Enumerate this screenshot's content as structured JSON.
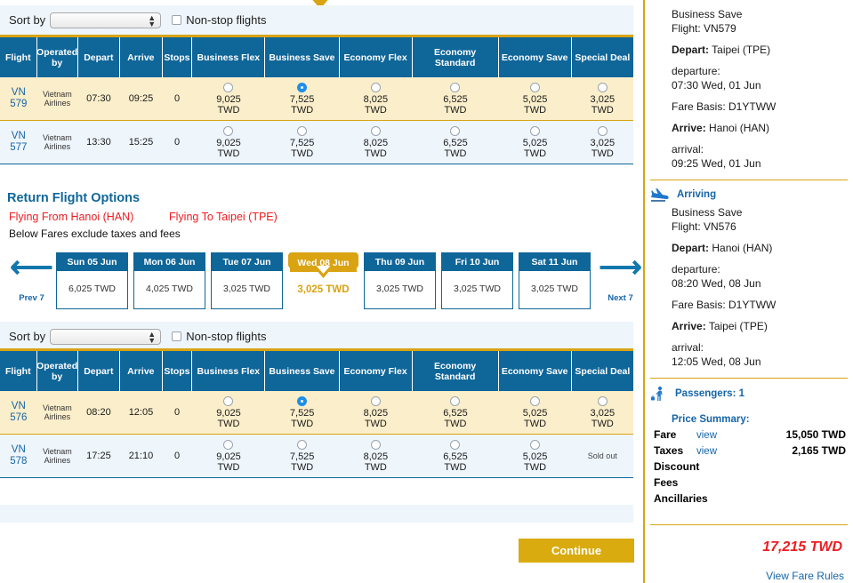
{
  "left": {
    "outbound_sortbar": {
      "sort_label": "Sort by",
      "sort_value": "",
      "nonstop_label": "Non-stop flights"
    },
    "return_sortbar": {
      "sort_label": "Sort by",
      "sort_value": "",
      "nonstop_label": "Non-stop flights"
    },
    "table_headers": [
      "Flight",
      "Operated by",
      "Depart",
      "Arrive",
      "Stops",
      "Business Flex",
      "Business Save",
      "Economy Flex",
      "Economy Standard",
      "Economy Save",
      "Special Deal"
    ],
    "outbound_rows": [
      {
        "flight": "VN 579",
        "operated_by": "Vietnam Airlines",
        "depart": "07:30",
        "arrive": "09:25",
        "stops": "0",
        "fares": [
          {
            "price": "9,025",
            "currency": "TWD",
            "selected": false,
            "sold_out": false
          },
          {
            "price": "7,525",
            "currency": "TWD",
            "selected": true,
            "sold_out": false
          },
          {
            "price": "8,025",
            "currency": "TWD",
            "selected": false,
            "sold_out": false
          },
          {
            "price": "6,525",
            "currency": "TWD",
            "selected": false,
            "sold_out": false
          },
          {
            "price": "5,025",
            "currency": "TWD",
            "selected": false,
            "sold_out": false
          },
          {
            "price": "3,025",
            "currency": "TWD",
            "selected": false,
            "sold_out": false
          }
        ]
      },
      {
        "flight": "VN 577",
        "operated_by": "Vietnam Airlines",
        "depart": "13:30",
        "arrive": "15:25",
        "stops": "0",
        "fares": [
          {
            "price": "9,025",
            "currency": "TWD",
            "selected": false,
            "sold_out": false
          },
          {
            "price": "7,525",
            "currency": "TWD",
            "selected": false,
            "sold_out": false
          },
          {
            "price": "8,025",
            "currency": "TWD",
            "selected": false,
            "sold_out": false
          },
          {
            "price": "6,525",
            "currency": "TWD",
            "selected": false,
            "sold_out": false
          },
          {
            "price": "5,025",
            "currency": "TWD",
            "selected": false,
            "sold_out": false
          },
          {
            "price": "3,025",
            "currency": "TWD",
            "selected": false,
            "sold_out": false
          }
        ]
      }
    ],
    "return_section": {
      "title": "Return Flight Options",
      "flying_from": "Flying From Hanoi (HAN)",
      "flying_to": "Flying To Taipei (TPE)",
      "note": "Below Fares exclude taxes and fees",
      "prev_label": "Prev 7",
      "next_label": "Next 7",
      "dates": [
        {
          "day": "Sun 05 Jun",
          "price": "6,025 TWD",
          "selected": false
        },
        {
          "day": "Mon 06 Jun",
          "price": "4,025 TWD",
          "selected": false
        },
        {
          "day": "Tue 07 Jun",
          "price": "3,025 TWD",
          "selected": false
        },
        {
          "day": "Wed 08 Jun",
          "price": "3,025 TWD",
          "selected": true
        },
        {
          "day": "Thu 09 Jun",
          "price": "3,025 TWD",
          "selected": false
        },
        {
          "day": "Fri 10 Jun",
          "price": "3,025 TWD",
          "selected": false
        },
        {
          "day": "Sat 11 Jun",
          "price": "3,025 TWD",
          "selected": false
        }
      ]
    },
    "return_rows": [
      {
        "flight": "VN 576",
        "operated_by": "Vietnam Airlines",
        "depart": "08:20",
        "arrive": "12:05",
        "stops": "0",
        "fares": [
          {
            "price": "9,025",
            "currency": "TWD",
            "selected": false,
            "sold_out": false
          },
          {
            "price": "7,525",
            "currency": "TWD",
            "selected": true,
            "sold_out": false
          },
          {
            "price": "8,025",
            "currency": "TWD",
            "selected": false,
            "sold_out": false
          },
          {
            "price": "6,525",
            "currency": "TWD",
            "selected": false,
            "sold_out": false
          },
          {
            "price": "5,025",
            "currency": "TWD",
            "selected": false,
            "sold_out": false
          },
          {
            "price": "3,025",
            "currency": "TWD",
            "selected": false,
            "sold_out": false
          }
        ]
      },
      {
        "flight": "VN 578",
        "operated_by": "Vietnam Airlines",
        "depart": "17:25",
        "arrive": "21:10",
        "stops": "0",
        "fares": [
          {
            "price": "9,025",
            "currency": "TWD",
            "selected": false,
            "sold_out": false
          },
          {
            "price": "7,525",
            "currency": "TWD",
            "selected": false,
            "sold_out": false
          },
          {
            "price": "8,025",
            "currency": "TWD",
            "selected": false,
            "sold_out": false
          },
          {
            "price": "6,525",
            "currency": "TWD",
            "selected": false,
            "sold_out": false
          },
          {
            "price": "5,025",
            "currency": "TWD",
            "selected": false,
            "sold_out": false
          },
          {
            "price": "",
            "currency": "",
            "selected": false,
            "sold_out": true,
            "sold_out_label": "Sold out"
          }
        ]
      }
    ],
    "continue_label": "Continue"
  },
  "right": {
    "departing": {
      "fare_name": "Business Save",
      "flight": "Flight: VN579",
      "depart_label": "Depart:",
      "depart_value": "Taipei (TPE)",
      "departure_label": "departure:",
      "departure_value": "07:30 Wed, 01 Jun",
      "fare_basis": "Fare Basis: D1YTWW",
      "arrive_label": "Arrive:",
      "arrive_value": "Hanoi (HAN)",
      "arrival_label": "arrival:",
      "arrival_value": "09:25 Wed, 01 Jun"
    },
    "arriving": {
      "section_label": "Arriving",
      "fare_name": "Business Save",
      "flight": "Flight: VN576",
      "depart_label": "Depart:",
      "depart_value": "Hanoi (HAN)",
      "departure_label": "departure:",
      "departure_value": "08:20 Wed, 08 Jun",
      "fare_basis": "Fare Basis: D1YTWW",
      "arrive_label": "Arrive:",
      "arrive_value": "Taipei (TPE)",
      "arrival_label": "arrival:",
      "arrival_value": "12:05 Wed, 08 Jun"
    },
    "passengers_label": "Passengers: 1",
    "price_summary_label": "Price Summary:",
    "price_rows": [
      {
        "label": "Fare",
        "link": "view",
        "amount": "15,050 TWD"
      },
      {
        "label": "Taxes",
        "link": "view",
        "amount": "2,165 TWD"
      },
      {
        "label": "Discount",
        "link": "",
        "amount": ""
      },
      {
        "label": "Fees",
        "link": "",
        "amount": ""
      },
      {
        "label": "Ancillaries",
        "link": "",
        "amount": ""
      }
    ],
    "total": "17,215 TWD",
    "fare_rules_link": "View Fare Rules"
  }
}
